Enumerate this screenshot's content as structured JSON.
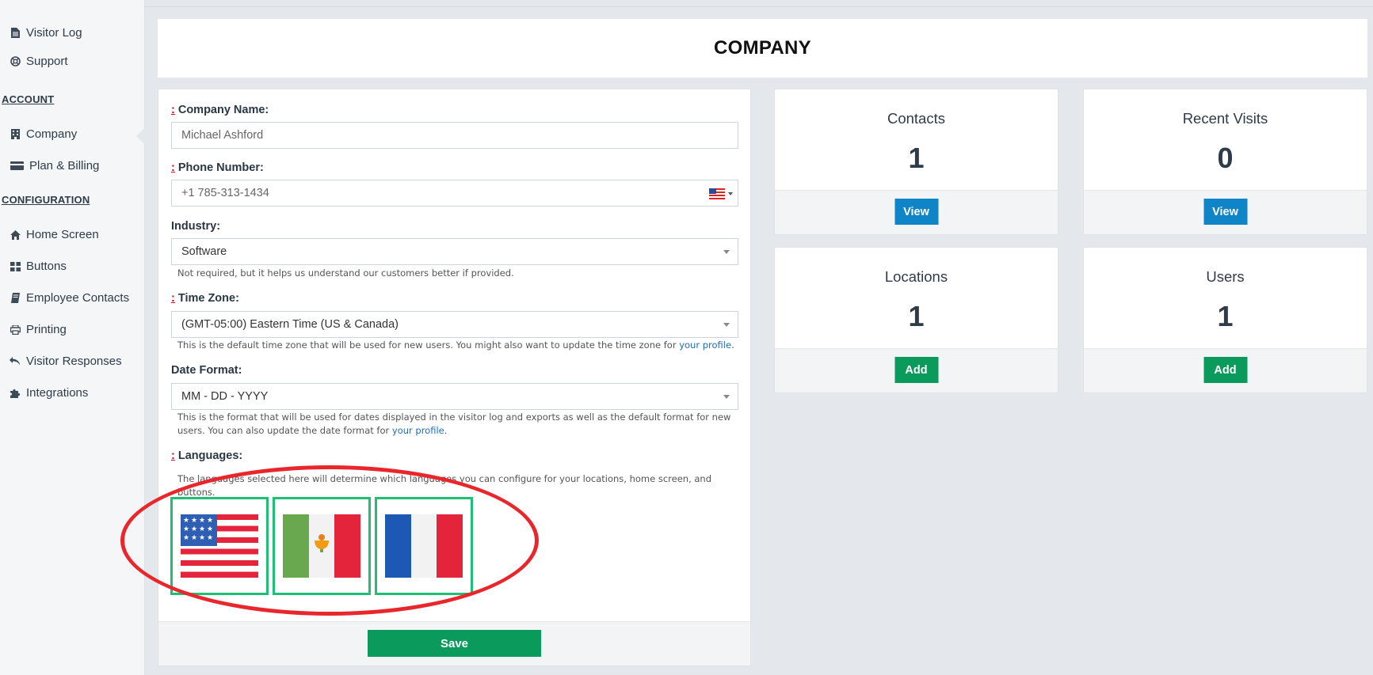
{
  "sidebar": {
    "items_top": [
      {
        "label": "Visitor Log",
        "icon": "document-icon"
      },
      {
        "label": "Support",
        "icon": "lifebuoy-icon"
      }
    ],
    "account_heading": "ACCOUNT",
    "account_items": [
      {
        "label": "Company",
        "icon": "building-icon"
      },
      {
        "label": "Plan & Billing",
        "icon": "credit-card-icon"
      }
    ],
    "config_heading": "CONFIGURATION",
    "config_items": [
      {
        "label": "Home Screen",
        "icon": "home-icon"
      },
      {
        "label": "Buttons",
        "icon": "grid-icon"
      },
      {
        "label": "Employee Contacts",
        "icon": "book-icon"
      },
      {
        "label": "Printing",
        "icon": "printer-icon"
      },
      {
        "label": "Visitor Responses",
        "icon": "reply-all-icon"
      },
      {
        "label": "Integrations",
        "icon": "puzzle-icon"
      }
    ]
  },
  "page": {
    "title": "COMPANY"
  },
  "form": {
    "company_name": {
      "label": "Company Name:",
      "value": "Michael Ashford"
    },
    "phone": {
      "label": "Phone Number:",
      "value": "+1 785-313-1434"
    },
    "industry": {
      "label": "Industry:",
      "value": "Software",
      "help": "Not required, but it helps us understand our customers better if provided."
    },
    "timezone": {
      "label": "Time Zone:",
      "value": "(GMT-05:00) Eastern Time (US & Canada)",
      "help": "This is the default time zone that will be used for new users. You might also want to update the time zone for ",
      "link": "your profile",
      "help_end": "."
    },
    "date_format": {
      "label": "Date Format:",
      "value": "MM - DD - YYYY",
      "help": "This is the format that will be used for dates displayed in the visitor log and exports as well as the default format for new users. You can also update the date format for ",
      "link": "your profile",
      "help_end": "."
    },
    "languages": {
      "label": "Languages:",
      "help": "The languages selected here will determine which languages you can configure for your locations, home screen, and buttons.",
      "flags": [
        "us-flag-icon",
        "mexico-flag-icon",
        "france-flag-icon"
      ]
    },
    "save_label": "Save",
    "required_mark": ":"
  },
  "stats": {
    "contacts": {
      "title": "Contacts",
      "value": "1",
      "button": "View"
    },
    "recent_visits": {
      "title": "Recent Visits",
      "value": "0",
      "button": "View"
    },
    "locations": {
      "title": "Locations",
      "value": "1",
      "button": "Add"
    },
    "users": {
      "title": "Users",
      "value": "1",
      "button": "Add"
    }
  },
  "colors": {
    "view_button": "#0f84c6",
    "add_button": "#0a9a5c",
    "flag_selected_border": "#1fc073",
    "annotation_circle": "#e8262c"
  }
}
